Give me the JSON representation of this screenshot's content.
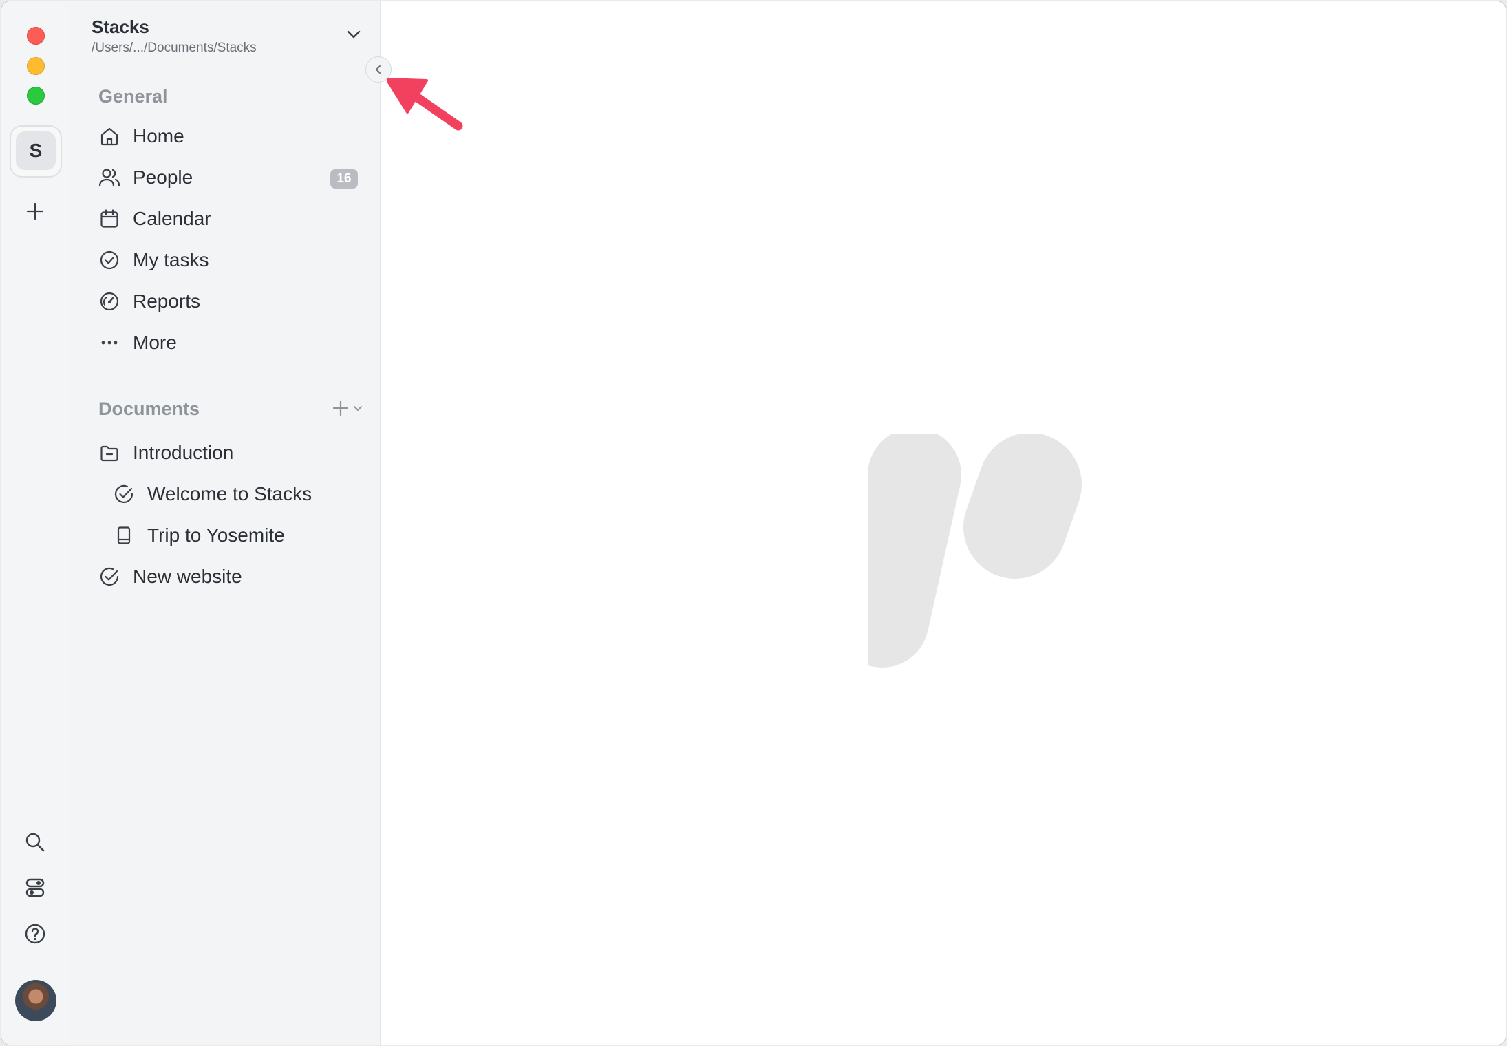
{
  "workspace": {
    "name": "Stacks",
    "path": "/Users/.../Documents/Stacks",
    "initial": "S"
  },
  "sidebar": {
    "general_title": "General",
    "general_items": [
      {
        "label": "Home",
        "icon": "home-icon"
      },
      {
        "label": "People",
        "icon": "people-icon",
        "badge": "16"
      },
      {
        "label": "Calendar",
        "icon": "calendar-icon"
      },
      {
        "label": "My tasks",
        "icon": "check-circle-icon"
      },
      {
        "label": "Reports",
        "icon": "gauge-icon"
      },
      {
        "label": "More",
        "icon": "more-dots-icon"
      }
    ],
    "documents_title": "Documents",
    "documents": [
      {
        "label": "Introduction",
        "icon": "folder-icon"
      },
      {
        "label": "Welcome to Stacks",
        "icon": "check-circle-icon"
      },
      {
        "label": "Trip to Yosemite",
        "icon": "book-icon"
      },
      {
        "label": "New website",
        "icon": "check-circle-icon"
      }
    ]
  },
  "rail": {
    "icons": [
      "plus-icon",
      "search-icon",
      "settings-toggles-icon",
      "help-icon"
    ]
  },
  "colors": {
    "traffic_red": "#fd5d55",
    "traffic_yellow": "#fdbb2f",
    "traffic_green": "#2ac93f",
    "annotation_arrow": "#f2405f",
    "logo_placeholder": "#e6e6e6"
  }
}
